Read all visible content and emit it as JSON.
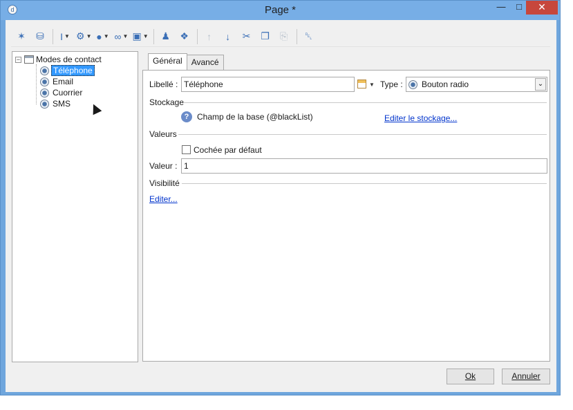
{
  "window": {
    "title": "Page *",
    "app_icon_glyph": "d",
    "minimize_glyph": "—",
    "maximize_glyph": "□",
    "close_glyph": "✕"
  },
  "toolbar": {
    "buttons": [
      {
        "icon": "magic-wand-icon",
        "glyph": "✶"
      },
      {
        "icon": "database-icon",
        "glyph": "⛁"
      },
      {
        "icon": "text-cursor-icon",
        "glyph": "I",
        "dropdown": true
      },
      {
        "icon": "form-gear-icon",
        "glyph": "⚙",
        "dropdown": true
      },
      {
        "icon": "globe-icon",
        "glyph": "●",
        "dropdown": true
      },
      {
        "icon": "link-icon",
        "glyph": "∞",
        "dropdown": true
      },
      {
        "icon": "box-icon",
        "glyph": "▣",
        "dropdown": true
      },
      {
        "icon": "user-icon",
        "glyph": "♟"
      },
      {
        "icon": "shapes-add-icon",
        "glyph": "❖"
      },
      {
        "icon": "move-up-icon",
        "glyph": "↑",
        "disabled": true
      },
      {
        "icon": "move-down-icon",
        "glyph": "↓"
      },
      {
        "icon": "cut-icon",
        "glyph": "✂"
      },
      {
        "icon": "copy-icon",
        "glyph": "❐"
      },
      {
        "icon": "paste-icon",
        "glyph": "⎘",
        "disabled": true
      },
      {
        "icon": "delete-icon",
        "glyph": "␡"
      }
    ],
    "dropdown_glyph": "▼"
  },
  "tree": {
    "root_label": "Modes de contact",
    "expander_glyph": "−",
    "items": [
      {
        "label": "Téléphone",
        "selected": true
      },
      {
        "label": "Email"
      },
      {
        "label": "Cuorrier"
      },
      {
        "label": "SMS"
      }
    ]
  },
  "tabs": [
    {
      "label": "Général",
      "active": true
    },
    {
      "label": "Avancé"
    }
  ],
  "form": {
    "libelle_label": "Libellé :",
    "libelle_value": "Téléphone",
    "type_label": "Type :",
    "type_value": "Bouton radio",
    "caret_glyph": "⌄",
    "stockage_title": "Stockage",
    "help_glyph": "?",
    "storage_text": "Champ de la base (@blackList)",
    "storage_link": "Editer le stockage...",
    "valeurs_title": "Valeurs",
    "checkbox_label": "Cochée par défaut",
    "checkbox_checked": false,
    "valeur_label": "Valeur :",
    "valeur_value": "1",
    "visibilite_title": "Visibilité",
    "visibilite_link": "Editer..."
  },
  "footer": {
    "ok_label": "Ok",
    "cancel_label": "Annuler"
  }
}
